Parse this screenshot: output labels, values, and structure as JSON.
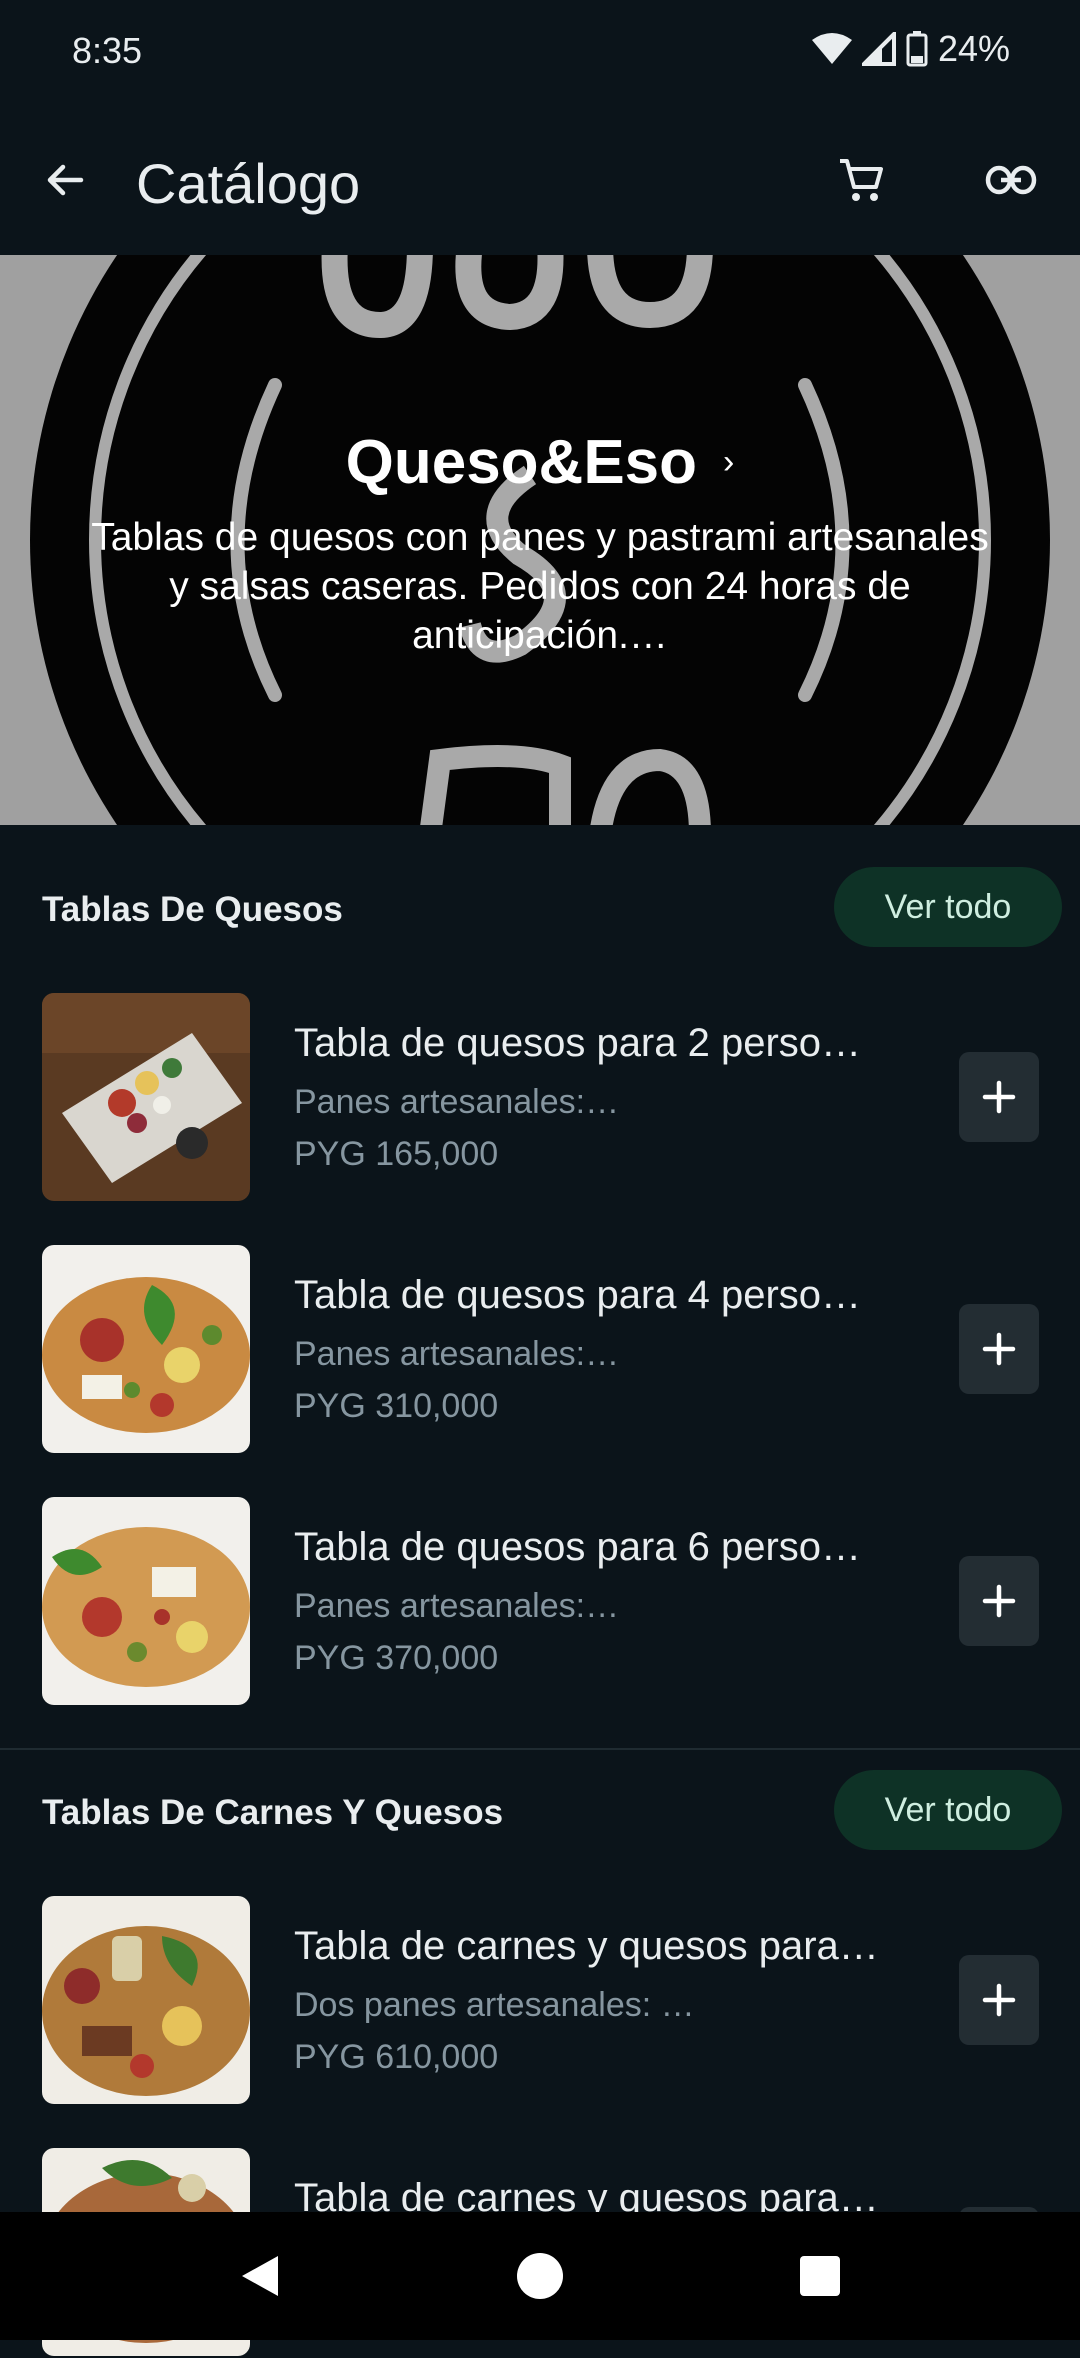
{
  "status": {
    "time": "8:35",
    "battery": "24%"
  },
  "app_bar": {
    "title": "Catálogo"
  },
  "hero": {
    "business_name": "Queso&Eso",
    "chevron": "›",
    "description": "Tablas de quesos con panes y pastrami artesanales y salsas caseras. Pedidos con 24 horas de anticipación.…"
  },
  "sections": [
    {
      "title": "Tablas De Quesos",
      "see_all": "Ver todo",
      "items": [
        {
          "title": "Tabla de quesos para 2 perso…",
          "desc": "Panes artesanales:…",
          "price": "PYG 165,000"
        },
        {
          "title": "Tabla de quesos para 4 perso…",
          "desc": "Panes artesanales:…",
          "price": "PYG 310,000"
        },
        {
          "title": "Tabla de quesos para 6 perso…",
          "desc": "Panes artesanales:…",
          "price": "PYG 370,000"
        }
      ]
    },
    {
      "title": "Tablas De Carnes Y Quesos",
      "see_all": "Ver todo",
      "items": [
        {
          "title": "Tabla de carnes y quesos para…",
          "desc": "Dos panes artesanales: …",
          "price": "PYG 610,000"
        },
        {
          "title": "Tabla de carnes y quesos para…",
          "desc": "",
          "price": ""
        }
      ]
    }
  ],
  "icons": {
    "back": "arrow-left-icon",
    "cart": "cart-icon",
    "link": "link-icon",
    "add": "plus-icon"
  },
  "colors": {
    "background": "#0b141a",
    "button_bg": "#0e3226",
    "button_text": "#cfeee0",
    "secondary_text": "#8696a0"
  }
}
